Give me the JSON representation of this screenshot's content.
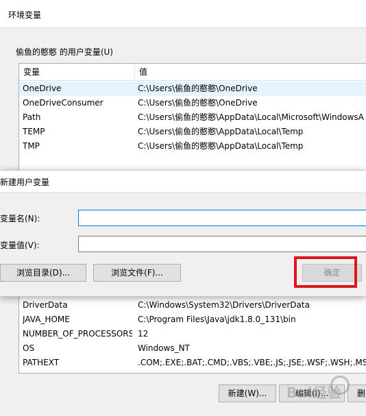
{
  "window": {
    "title": "环境变量"
  },
  "user_vars": {
    "group_label": "偷鱼的憨憨 的用户变量(U)",
    "headers": {
      "name": "变量",
      "value": "值"
    },
    "rows": [
      {
        "name": "OneDrive",
        "value": "C:\\Users\\偷鱼的憨憨\\OneDrive"
      },
      {
        "name": "OneDriveConsumer",
        "value": "C:\\Users\\偷鱼的憨憨\\OneDrive"
      },
      {
        "name": "Path",
        "value": "C:\\Users\\偷鱼的憨憨\\AppData\\Local\\Microsoft\\WindowsA"
      },
      {
        "name": "TEMP",
        "value": "C:\\Users\\偷鱼的憨憨\\AppData\\Local\\Temp"
      },
      {
        "name": "TMP",
        "value": "C:\\Users\\偷鱼的憨憨\\AppData\\Local\\Temp"
      }
    ]
  },
  "system_vars": {
    "rows": [
      {
        "name": "DriverData",
        "value": "C:\\Windows\\System32\\Drivers\\DriverData"
      },
      {
        "name": "JAVA_HOME",
        "value": "C:\\Program Files\\Java\\jdk1.8.0_131\\bin"
      },
      {
        "name": "NUMBER_OF_PROCESSORS",
        "value": "12"
      },
      {
        "name": "OS",
        "value": "Windows_NT"
      },
      {
        "name": "PATHEXT",
        "value": ".COM;.EXE;.BAT;.CMD;.VBS;.VBE;.JS;.JSE;.WSF;.WSH;.MSC"
      }
    ],
    "buttons": {
      "new": "新建(W)...",
      "edit": "编辑(I)...",
      "extra": "删"
    }
  },
  "dialog": {
    "title": "新建用户变量",
    "name_label": "变量名(N):",
    "value_label": "变量值(V):",
    "name_value": "",
    "value_value": "",
    "browse_dir": "浏览目录(D)...",
    "browse_file": "浏览文件(F)...",
    "ok": "确定"
  },
  "watermark": {
    "text": "Bai经验"
  },
  "colors": {
    "highlight": "#e0141e",
    "selection": "#e5f3ff",
    "focus_border": "#0078d7"
  }
}
